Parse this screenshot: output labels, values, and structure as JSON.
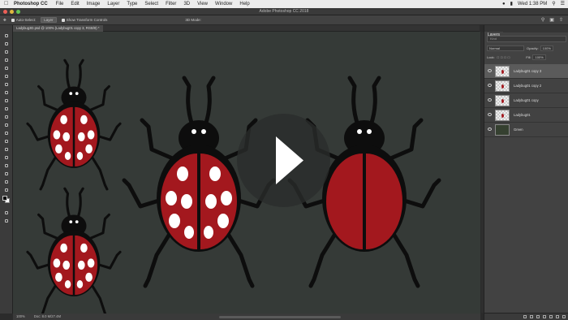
{
  "menubar": {
    "app": "Photoshop CC",
    "items": [
      "File",
      "Edit",
      "Image",
      "Layer",
      "Type",
      "Select",
      "Filter",
      "3D",
      "View",
      "Window",
      "Help"
    ],
    "clock": "Wed 1:38 PM"
  },
  "window": {
    "title": "Adobe Photoshop CC 2018"
  },
  "options": {
    "auto_select": "Auto-Select:",
    "auto_select_value": "Layer",
    "transform": "Show Transform Controls",
    "mode3d": "3D Mode:"
  },
  "document": {
    "tab": "Ladybug3D.psd @ 100% (Ladybug01 copy 3, RGB/8) *"
  },
  "status": {
    "zoom": "100%",
    "doc": "Doc: 8.0 M/27.4M"
  },
  "layers_panel": {
    "title": "Layers",
    "filter_placeholder": "Kind",
    "blend_mode": "Normal",
    "opacity_label": "Opacity:",
    "opacity": "100%",
    "lock_label": "Lock:",
    "fill_label": "Fill:",
    "fill": "100%",
    "layers": [
      {
        "name": "Ladybug01 copy 3",
        "selected": true
      },
      {
        "name": "Ladybug01 copy 2",
        "selected": false
      },
      {
        "name": "Ladybug01 copy",
        "selected": false
      },
      {
        "name": "Ladybug01",
        "selected": false
      },
      {
        "name": "Green",
        "selected": false
      }
    ]
  },
  "colors": {
    "canvas_bg": "#353a37",
    "ladybug_red": "#a3181e",
    "ladybug_black": "#0d0d0d",
    "spot_white": "#ffffff"
  },
  "icons": {
    "play": "play-icon",
    "apple": "apple-icon",
    "eye": "eye-icon",
    "move_tool": "move-tool-icon",
    "search": "search-icon"
  }
}
